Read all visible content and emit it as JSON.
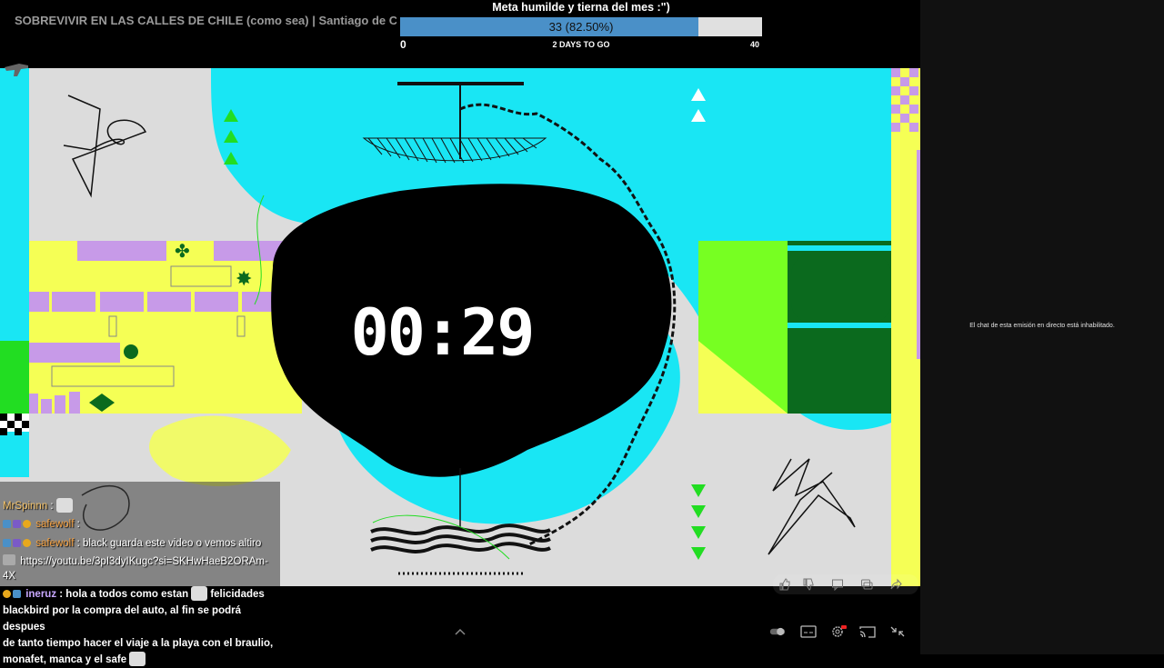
{
  "video": {
    "title": "SOBREVIVIR EN LAS CALLES DE CHILE (como sea) | Santiago de Chile"
  },
  "goal": {
    "title": "Meta humilde y tierna del mes :\")",
    "progress_text": "33 (82.50%)",
    "progress_fraction": 0.825,
    "min_label": "0",
    "days_left": "2 DAYS TO GO",
    "max_label": "40",
    "fill_color": "#4a90c8"
  },
  "timer": {
    "display": "00:29"
  },
  "overlay_chat": {
    "lines": [
      {
        "user": "MrSpinnn",
        "sep": " :",
        "message": ""
      },
      {
        "user": "safewolf",
        "sep": " :",
        "message": ""
      },
      {
        "user": "safewolf",
        "sep": " :",
        "message": " black guarda este video o vemos altiro"
      },
      {
        "user": "",
        "sep": "",
        "message": "https://youtu.be/3pI3dyIKugc?si=SKHwHaeB2ORAm-"
      },
      {
        "user": "",
        "sep": "",
        "message": "4X"
      }
    ]
  },
  "bottom_chat": {
    "user": "ineruz",
    "lines": [
      " : hola a todos como estan",
      " felicidades",
      "blackbird por la compra del auto, al fin se podrá despues",
      "de tanto tiempo hacer el viaje a la playa con el braulio,",
      "monafet, manca y el safe"
    ]
  },
  "right_panel": {
    "chat_disabled_text": "El chat de esta emisión en directo está inhabilitado."
  },
  "icons": {
    "left_sidebar": "rifle-icon",
    "right_sidebar": "rifle-icon",
    "pinned_actions": [
      "thumbs-up-icon",
      "thumbs-down-icon",
      "comment-icon",
      "chat-bubbles-icon",
      "share-icon"
    ],
    "controls": [
      "chevron-up-icon",
      "autoplay-toggle-icon",
      "subtitles-icon",
      "settings-icon",
      "cast-icon",
      "exit-fullscreen-icon"
    ]
  }
}
